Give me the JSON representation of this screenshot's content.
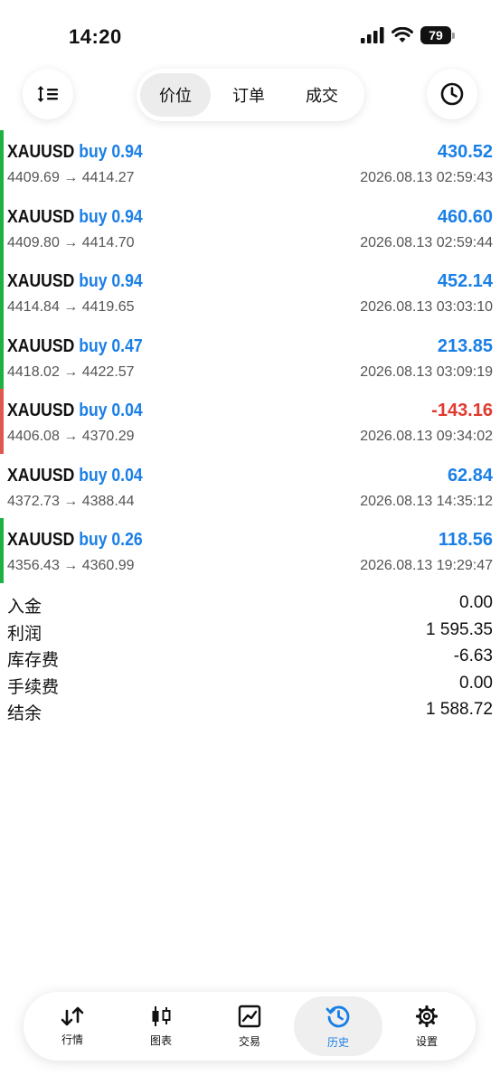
{
  "status": {
    "time": "14:20",
    "battery": "79"
  },
  "header": {
    "tabs": [
      {
        "label": "价位",
        "active": true
      },
      {
        "label": "订单",
        "active": false
      },
      {
        "label": "成交",
        "active": false
      }
    ],
    "left_icon": "sort-icon",
    "right_icon": "clock-icon"
  },
  "colors": {
    "accent": "#1a7fe6",
    "profit_bar": "#1eb041",
    "loss_bar": "#e0574f",
    "loss_text": "#e03a2f"
  },
  "deals": [
    {
      "symbol": "XAUUSD",
      "side": "buy 0.94",
      "profit": "430.52",
      "prices": "4409.69 → 4414.27",
      "time": "2026.08.13 02:59:43",
      "status": "profit"
    },
    {
      "symbol": "XAUUSD",
      "side": "buy 0.94",
      "profit": "460.60",
      "prices": "4409.80 → 4414.70",
      "time": "2026.08.13 02:59:44",
      "status": "profit"
    },
    {
      "symbol": "XAUUSD",
      "side": "buy 0.94",
      "profit": "452.14",
      "prices": "4414.84 → 4419.65",
      "time": "2026.08.13 03:03:10",
      "status": "profit"
    },
    {
      "symbol": "XAUUSD",
      "side": "buy 0.47",
      "profit": "213.85",
      "prices": "4418.02 → 4422.57",
      "time": "2026.08.13 03:09:19",
      "status": "profit"
    },
    {
      "symbol": "XAUUSD",
      "side": "buy 0.04",
      "profit": "-143.16",
      "prices": "4406.08 → 4370.29",
      "time": "2026.08.13 09:34:02",
      "status": "loss"
    },
    {
      "symbol": "XAUUSD",
      "side": "buy 0.04",
      "profit": "62.84",
      "prices": "4372.73 → 4388.44",
      "time": "2026.08.13 14:35:12",
      "status": "none"
    },
    {
      "symbol": "XAUUSD",
      "side": "buy 0.26",
      "profit": "118.56",
      "prices": "4356.43 → 4360.99",
      "time": "2026.08.13 19:29:47",
      "status": "profit"
    }
  ],
  "summary": [
    {
      "label": "入金",
      "value": "0.00"
    },
    {
      "label": "利润",
      "value": "1 595.35"
    },
    {
      "label": "库存费",
      "value": "-6.63"
    },
    {
      "label": "手续费",
      "value": "0.00"
    },
    {
      "label": "结余",
      "value": "1 588.72"
    }
  ],
  "tabbar": [
    {
      "label": "行情",
      "icon": "quotes-icon",
      "active": false
    },
    {
      "label": "图表",
      "icon": "chart-icon",
      "active": false
    },
    {
      "label": "交易",
      "icon": "trade-icon",
      "active": false
    },
    {
      "label": "历史",
      "icon": "history-icon",
      "active": true
    },
    {
      "label": "设置",
      "icon": "settings-icon",
      "active": false
    }
  ]
}
